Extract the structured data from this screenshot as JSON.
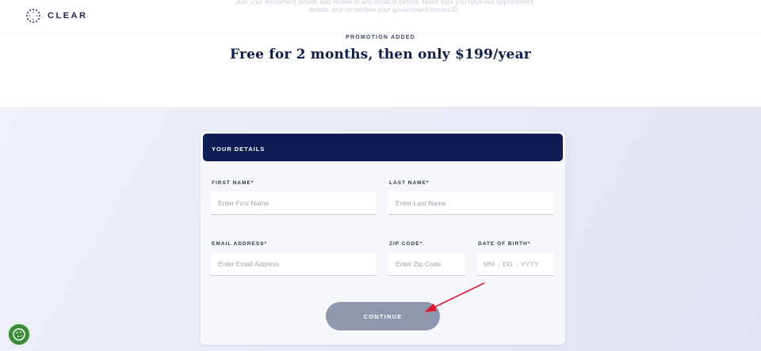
{
  "header": {
    "logo_text": "CLEAR",
    "faded_text": "Join your enrollment details and review at any location before. Make sure you have our appointment details, and remember your government-issued ID."
  },
  "promo": {
    "label": "PROMOTION ADDED",
    "title": "Free for 2 months, then only $199/year"
  },
  "form": {
    "header": "YOUR DETAILS",
    "first_name": {
      "label": "FIRST NAME*",
      "placeholder": "Enter First Name"
    },
    "last_name": {
      "label": "LAST NAME*",
      "placeholder": "Enter Last Name"
    },
    "email": {
      "label": "EMAIL ADDRESS*",
      "placeholder": "Enter Email Address"
    },
    "zip": {
      "label": "ZIP CODE*",
      "placeholder": "Enter Zip Code"
    },
    "dob": {
      "label": "DATE OF BIRTH*",
      "mm": "MM",
      "dd": "DD",
      "yyyy": "YYYY",
      "sep": "|"
    },
    "continue_label": "CONTINUE"
  },
  "colors": {
    "navy": "#0d1c52",
    "button": "#8f96ae",
    "annotation_arrow": "#e0182d",
    "cookie": "#3d8c3a"
  },
  "icons": {
    "logo": "clear-logo-icon",
    "cookie": "cookie-icon",
    "arrow": "annotation-arrow"
  }
}
